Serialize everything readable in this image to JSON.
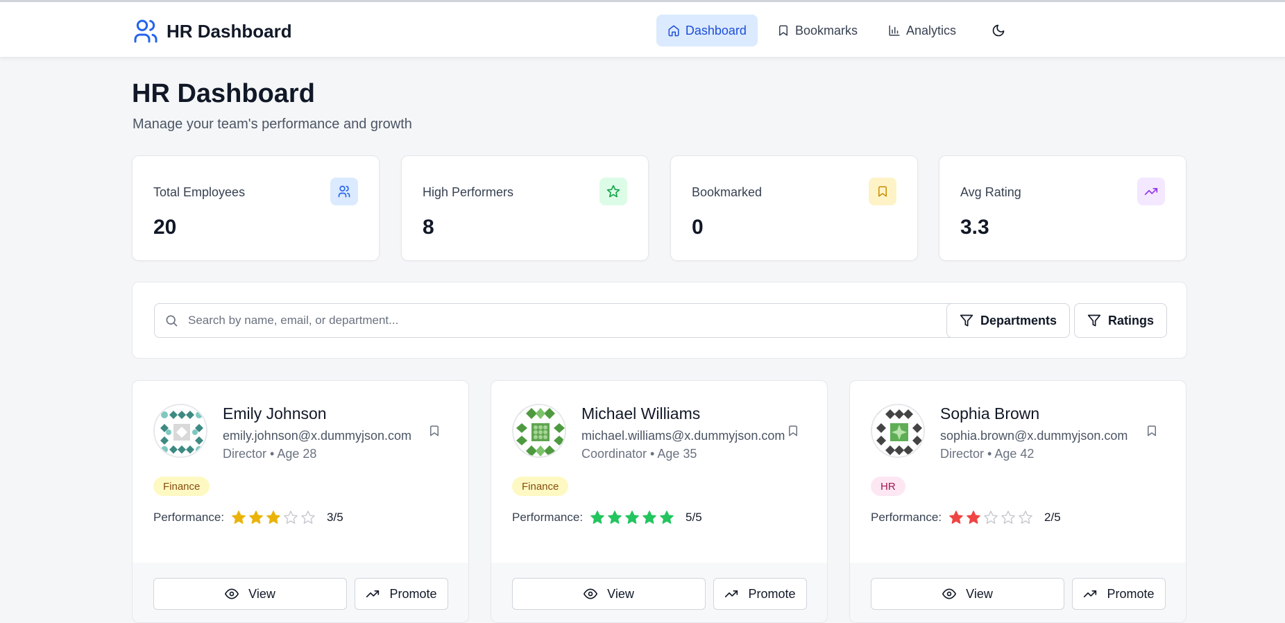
{
  "navbar": {
    "brand": "HR Dashboard",
    "items": [
      {
        "label": "Dashboard",
        "icon": "home-icon",
        "active": true
      },
      {
        "label": "Bookmarks",
        "icon": "bookmark-icon",
        "active": false
      },
      {
        "label": "Analytics",
        "icon": "bar-chart-icon",
        "active": false
      }
    ],
    "theme_icon": "moon-icon"
  },
  "header": {
    "title": "HR Dashboard",
    "subtitle": "Manage your team's performance and growth"
  },
  "stats": [
    {
      "label": "Total Employees",
      "value": "20",
      "icon": "users-icon",
      "icon_bg": "#dbeafe",
      "icon_color": "#2563eb"
    },
    {
      "label": "High Performers",
      "value": "8",
      "icon": "star-icon",
      "icon_bg": "#dcfce7",
      "icon_color": "#16a34a"
    },
    {
      "label": "Bookmarked",
      "value": "0",
      "icon": "bookmark-icon",
      "icon_bg": "#fef3c7",
      "icon_color": "#ca8a04"
    },
    {
      "label": "Avg Rating",
      "value": "3.3",
      "icon": "trending-up-icon",
      "icon_bg": "#f3e8ff",
      "icon_color": "#9333ea"
    }
  ],
  "search": {
    "placeholder": "Search by name, email, or department...",
    "value": "",
    "filters": [
      {
        "label": "Departments",
        "icon": "filter-icon"
      },
      {
        "label": "Ratings",
        "icon": "filter-icon"
      }
    ]
  },
  "employees": [
    {
      "name": "Emily Johnson",
      "email": "emily.johnson@x.dummyjson.com",
      "role_age": "Director • Age 28",
      "department": "Finance",
      "dept_bg": "#fef9c3",
      "dept_color": "#854d0e",
      "performance_label": "Performance:",
      "rating": 3,
      "rating_text": "3/5",
      "star_color": "#eab308",
      "view_label": "View",
      "promote_label": "Promote"
    },
    {
      "name": "Michael Williams",
      "email": "michael.williams@x.dummyjson.com",
      "role_age": "Coordinator • Age 35",
      "department": "Finance",
      "dept_bg": "#fef9c3",
      "dept_color": "#854d0e",
      "performance_label": "Performance:",
      "rating": 5,
      "rating_text": "5/5",
      "star_color": "#22c55e",
      "view_label": "View",
      "promote_label": "Promote"
    },
    {
      "name": "Sophia Brown",
      "email": "sophia.brown@x.dummyjson.com",
      "role_age": "Director • Age 42",
      "department": "HR",
      "dept_bg": "#fce7f3",
      "dept_color": "#9d174d",
      "performance_label": "Performance:",
      "rating": 2,
      "rating_text": "2/5",
      "star_color": "#ef4444",
      "view_label": "View",
      "promote_label": "Promote"
    }
  ]
}
